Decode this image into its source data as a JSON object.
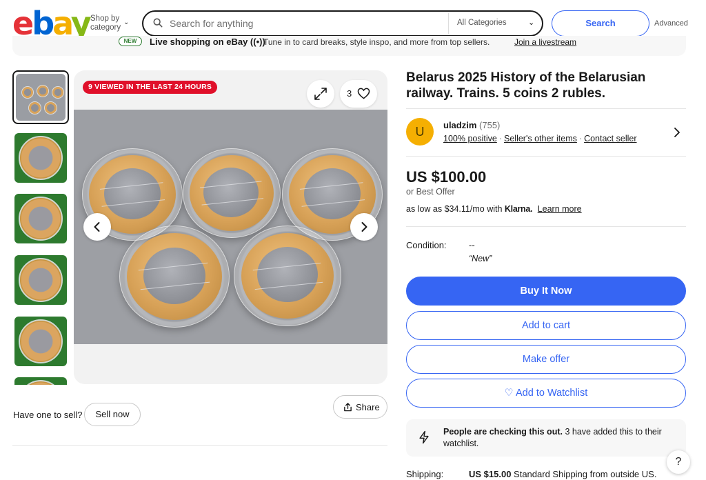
{
  "header": {
    "logo": {
      "e": "e",
      "b": "b",
      "a": "a",
      "y": "y"
    },
    "shop_by_line1": "Shop by",
    "shop_by_line2": "category",
    "search_placeholder": "Search for anything",
    "category_selected": "All Categories",
    "search_button": "Search",
    "advanced_link": "Advanced"
  },
  "promo": {
    "badge": "NEW",
    "headline": "Live shopping on eBay",
    "text": "Tune in to card breaks, style inspo, and more from top sellers.",
    "link": "Join a livestream"
  },
  "gallery": {
    "viewed_badge": "9 VIEWED IN THE LAST 24 HOURS",
    "watch_count": "3",
    "thumbnail_count": 6
  },
  "sell": {
    "question": "Have one to sell?",
    "sell_button": "Sell now",
    "share_button": "Share"
  },
  "listing": {
    "title": "Belarus 2025 History of the Belarusian railway. Trains. 5 coins 2 rubles.",
    "seller": {
      "avatar_letter": "U",
      "name": "uladzim",
      "feedback_count": "(755)",
      "positive": "100% positive",
      "other_items": "Seller's other items",
      "contact": "Contact seller"
    },
    "price": "US $100.00",
    "best_offer": "or Best Offer",
    "klarna": {
      "prefix": "as low as $34.11/mo with",
      "brand": "Klarna.",
      "learn_more": "Learn more"
    },
    "condition_label": "Condition:",
    "condition_value": "--",
    "condition_note": "“New”",
    "buttons": {
      "buy_now": "Buy It Now",
      "add_to_cart": "Add to cart",
      "make_offer": "Make offer",
      "watchlist": "♡ Add to Watchlist"
    },
    "notice": {
      "bold": "People are checking this out.",
      "rest": " 3 have added this to their watchlist."
    },
    "shipping_label": "Shipping:",
    "shipping_price": "US $15.00",
    "shipping_desc": " Standard Shipping from outside US."
  },
  "help_button": "?",
  "colors": {
    "accent_blue": "#3665f3",
    "badge_red": "#e0102a",
    "avatar_yellow": "#f5af02"
  }
}
